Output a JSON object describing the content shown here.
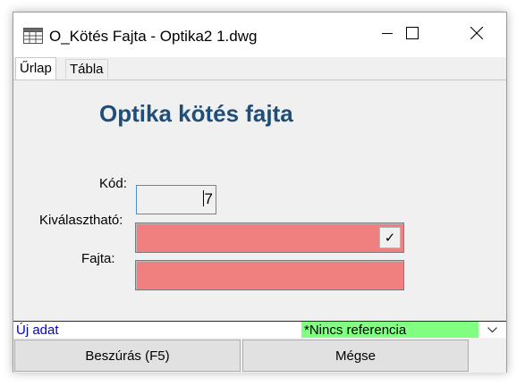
{
  "window": {
    "title": "O_Kötés Fajta - Optika2 1.dwg",
    "icons": {
      "app": "table-window-icon",
      "minimize": "minimize-icon",
      "maximize": "maximize-icon",
      "close": "close-icon"
    }
  },
  "tabs": [
    {
      "label": "Űrlap",
      "active": true
    },
    {
      "label": "Tábla",
      "active": false
    }
  ],
  "form": {
    "heading": "Optika kötés fajta",
    "fields": {
      "kod": {
        "label": "Kód:",
        "value": "7"
      },
      "kivalaszthato": {
        "label": "Kiválasztható:",
        "value": "",
        "check_glyph": "✓"
      },
      "fajta": {
        "label": "Fajta:",
        "value": ""
      }
    },
    "required_field_color": "#f08080"
  },
  "status": {
    "mode": "Új adat",
    "reference": "*Nincs referencia",
    "reference_color": "#80ff80"
  },
  "buttons": {
    "insert": "Beszúrás (F5)",
    "cancel": "Mégse"
  }
}
